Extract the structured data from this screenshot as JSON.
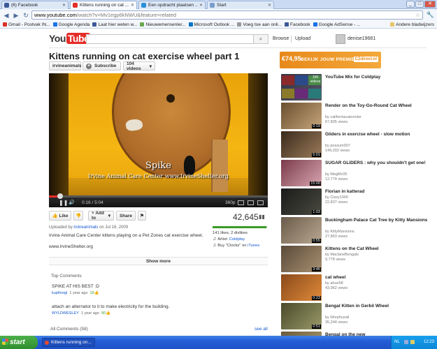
{
  "browser": {
    "tabs": [
      {
        "label": "(6) Facebook",
        "active": false,
        "icon_color": "#3b5998"
      },
      {
        "label": "Kittens running on cat ...",
        "active": true,
        "icon_color": "#e52d27"
      },
      {
        "label": "Een opdracht plaatsen ...",
        "active": false,
        "icon_color": "#2a8fd8"
      },
      {
        "label": "Start",
        "active": false,
        "icon_color": "#7a9ccc"
      }
    ],
    "window_buttons": [
      "_",
      "□",
      "✕"
    ],
    "url_host": "www.youtube.com",
    "url_rest": "/watch?v=Mv1egp6kNWU&feature=related",
    "bookmarks": [
      {
        "label": "Gmail - Postvak IN...",
        "color": "#d93025"
      },
      {
        "label": "Google Agenda",
        "color": "#1a73e8"
      },
      {
        "label": "Laat hier weten w...",
        "color": "#3b5998"
      },
      {
        "label": "Nieuwemensenler...",
        "color": "#6aa84f"
      },
      {
        "label": "Microsoft Outlook ...",
        "color": "#0072c6"
      },
      {
        "label": "Voeg toe aan onli...",
        "color": "#999999"
      },
      {
        "label": "Facebook",
        "color": "#3b5998"
      },
      {
        "label": "Google AdSense - ...",
        "color": "#1a73e8"
      }
    ],
    "other_bookmarks": "Andere bladwijzers"
  },
  "youtube": {
    "logo_you": "You",
    "logo_tube": "Tube",
    "browse": "Browse",
    "upload": "Upload",
    "username": "denise19681",
    "title": "Kittens running on cat exercise wheel part 1",
    "channel": "irvineanimals",
    "subscribe": "Subscribe",
    "videos_count": "104 videos",
    "overlay_name": "Spike",
    "overlay_credit": "Irvine Animal Care Center  www.IrvineShelter.org",
    "time": "0:16 / 5:04",
    "quality": "360p",
    "progress": 0.05,
    "like": "Like",
    "add_to": "+ Add to",
    "share": "Share",
    "views": "42,645",
    "likes_ratio": 0.986,
    "uploaded_prefix": "Uploaded by",
    "uploaded_by": "irvineanimals",
    "uploaded_date": "on Jul 16, 2009",
    "description": "Irvine Animal Care Center kittens playing on a Pet Zones cat exercise wheel.",
    "desc_url": "www.IrvineShelter.org",
    "likes_text": "141 likes, 2 dislikes",
    "artist_prefix": "Artist:",
    "artist": "Coldplay",
    "buy_prefix": "Buy \"Clocks\" on",
    "buy_store": "iTunes",
    "show_more": "Show more",
    "top_comments": "Top Comments",
    "comments": [
      {
        "text": "SPIKE AT HIS BEST :D",
        "author": "kupfmogl",
        "age": "1 year ago",
        "votes": "19"
      },
      {
        "text": "attach an alternator to it to make electricity for the building.",
        "author": "WYLDWESLEY",
        "age": "1 year ago",
        "votes": "50"
      }
    ],
    "all_comments": "All Comments (58)",
    "see_all": "see all"
  },
  "ad": {
    "price": "€74,95",
    "text": "BEKIJK JOUW PREMIE",
    "logo": "CZdirect.nl"
  },
  "sidebar": [
    {
      "title": "YouTube Mix for Coldplay",
      "by": "",
      "views": "",
      "duration": "",
      "color1": "#334",
      "color2": "#556"
    },
    {
      "title": "Render on the Toy-Go-Round Cat Wheel",
      "by": "by californiacatcenter",
      "views": "67,805 views",
      "duration": "0:19",
      "color1": "#6a5030",
      "color2": "#c7a57a"
    },
    {
      "title": "Gliders in exercise wheel - slow motion",
      "by": "by possum007",
      "views": "149,202 views",
      "duration": "5:01",
      "color1": "#3a2a1c",
      "color2": "#9b7b5a"
    },
    {
      "title": "SUGAR GLIDERS : why you shouldn't get one!",
      "by": "by MegMc05",
      "views": "12,774 views",
      "duration": "15:00",
      "color1": "#7a3a4a",
      "color2": "#d8a6b0"
    },
    {
      "title": "Florian in katterad",
      "by": "by Cissy1000",
      "views": "22,837 views",
      "duration": "1:03",
      "color1": "#1a1a1a",
      "color2": "#4a4a40"
    },
    {
      "title": "Buckingham Palace Cat Tree by Kitty Mansions",
      "by": "by KittyMansions",
      "views": "27,863 views",
      "duration": "0:55",
      "color1": "#6a5a4a",
      "color2": "#b9a890"
    },
    {
      "title": "Kittens on the Cat Wheel",
      "by": "by MaclaneBengals",
      "views": "9,778 views",
      "duration": "3:46",
      "color1": "#5a4a3a",
      "color2": "#a89070"
    },
    {
      "title": "cat wheel",
      "by": "by ahue58",
      "views": "43,962 views",
      "duration": "0:23",
      "color1": "#8a4a1a",
      "color2": "#e08a3a"
    },
    {
      "title": "Bengal Kitten in Gerbil Wheel",
      "by": "by Morphuzail",
      "views": "35,244 views",
      "duration": "0:51",
      "color1": "#4a4a2a",
      "color2": "#9a9a6a"
    },
    {
      "title": "Bengal on the new",
      "by": "",
      "views": "",
      "duration": "",
      "color1": "#6a5a3a",
      "color2": "#b0a070"
    }
  ],
  "mix_count": "100 videos",
  "taskbar": {
    "start": "start",
    "task": "Kittens running on...",
    "lang": "NL",
    "clock": "12:23"
  }
}
